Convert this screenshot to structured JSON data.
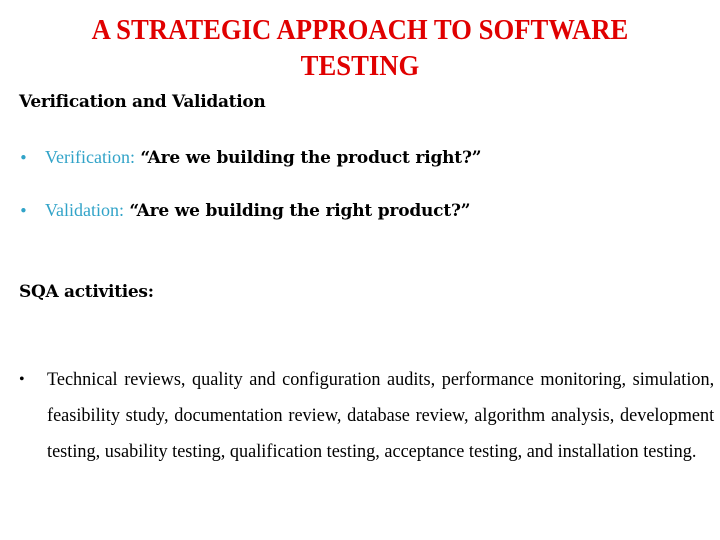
{
  "slide": {
    "title_line1": "A STRATEGIC APPROACH TO SOFTWARE",
    "title_line2": "TESTING",
    "colors": {
      "title": "#e00000",
      "accent": "#31a3c8",
      "text": "#000000"
    },
    "section1": {
      "heading": "Verification and Validation",
      "bullets": [
        {
          "bullet_icon": "bullet-dot",
          "term": "Verification:",
          "text": "“Are we building the product right?”"
        },
        {
          "bullet_icon": "bullet-dot",
          "term": "Validation:",
          "text": "“Are we building the right product?”"
        }
      ]
    },
    "section2": {
      "heading": "SQA activities:",
      "bullet_icon": "bullet-dot",
      "text": "Technical reviews, quality and configuration audits, performance monitoring, simulation, feasibility study, documentation review, database review, algorithm analysis, development testing, usability testing, qualification testing, acceptance testing, and installation testing."
    }
  }
}
